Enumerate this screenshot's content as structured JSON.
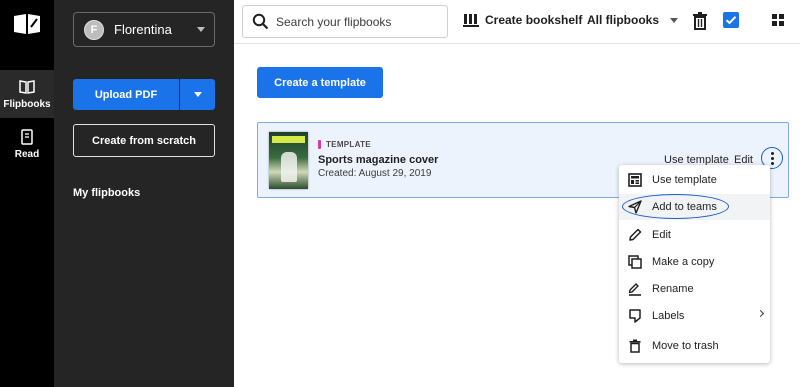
{
  "rail": {
    "items": [
      {
        "label": "Flipbooks",
        "icon": "book-open-icon",
        "active": true
      },
      {
        "label": "Read",
        "icon": "document-icon",
        "active": false
      }
    ]
  },
  "panel": {
    "account": {
      "initial": "F",
      "name": "Florentina"
    },
    "upload_label": "Upload PDF",
    "scratch_label": "Create from scratch",
    "my_flipbooks": "My flipbooks"
  },
  "topbar": {
    "search_placeholder": "Search your flipbooks",
    "bookshelf_label": "Create bookshelf",
    "filter_label": "All flipbooks",
    "select_all_checked": true
  },
  "main": {
    "create_template_label": "Create a template",
    "card": {
      "tag": "TEMPLATE",
      "title": "Sports magazine cover",
      "date": "Created: August 29, 2019",
      "use_label": "Use template",
      "edit_label": "Edit"
    }
  },
  "menu": {
    "items": [
      {
        "label": "Use template",
        "icon": "template-icon"
      },
      {
        "label": "Add to teams",
        "icon": "send-icon",
        "highlighted": true
      },
      {
        "label": "Edit",
        "icon": "pencil-icon"
      },
      {
        "label": "Make a copy",
        "icon": "copy-icon"
      },
      {
        "label": "Rename",
        "icon": "rename-icon"
      },
      {
        "label": "Labels",
        "icon": "label-icon",
        "submenu": true
      },
      {
        "label": "Move to trash",
        "icon": "trash-icon"
      }
    ]
  },
  "colors": {
    "accent": "#1a73e8",
    "rail_bg": "#000000",
    "panel_bg": "#252525",
    "template_tag": "#d63aaa",
    "card_bg": "#edf3fd"
  }
}
